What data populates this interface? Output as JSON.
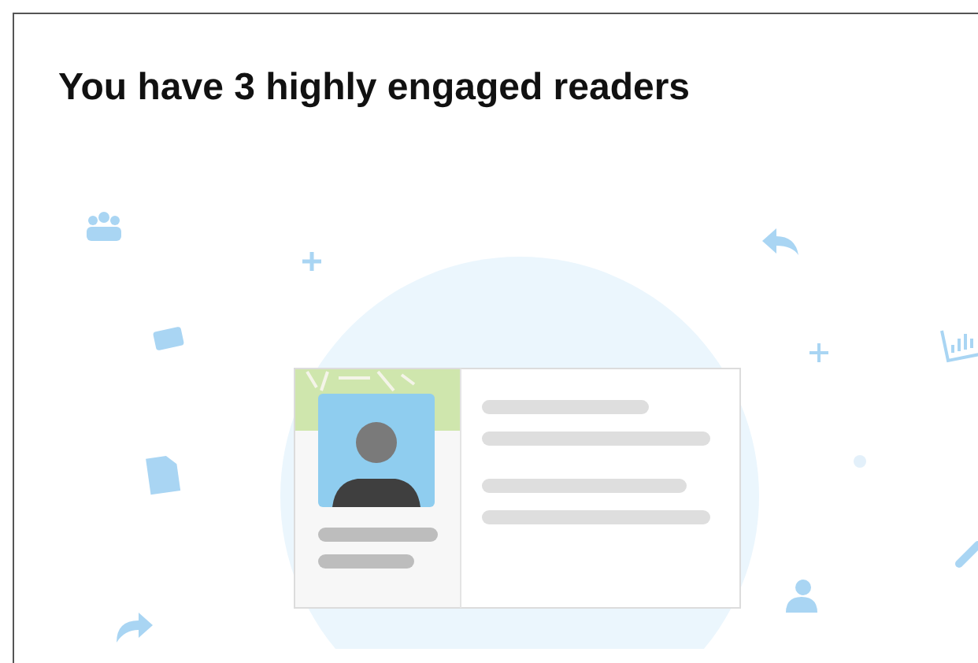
{
  "title": "You have 3 highly engaged readers"
}
